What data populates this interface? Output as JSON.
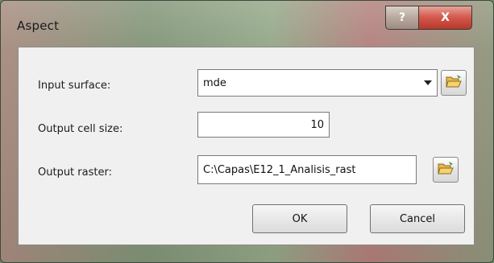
{
  "window": {
    "title": "Aspect",
    "help_label": "?",
    "close_label": "X"
  },
  "form": {
    "input_surface": {
      "label": "Input surface:",
      "value": "mde"
    },
    "output_cell_size": {
      "label": "Output cell size:",
      "value": "10"
    },
    "output_raster": {
      "label": "Output raster:",
      "value": "C:\\Capas\\E12_1_Analisis_rast"
    }
  },
  "buttons": {
    "ok_label": "OK",
    "cancel_label": "Cancel"
  },
  "icons": {
    "browse": "folder-open-icon",
    "dropdown": "chevron-down-icon"
  }
}
